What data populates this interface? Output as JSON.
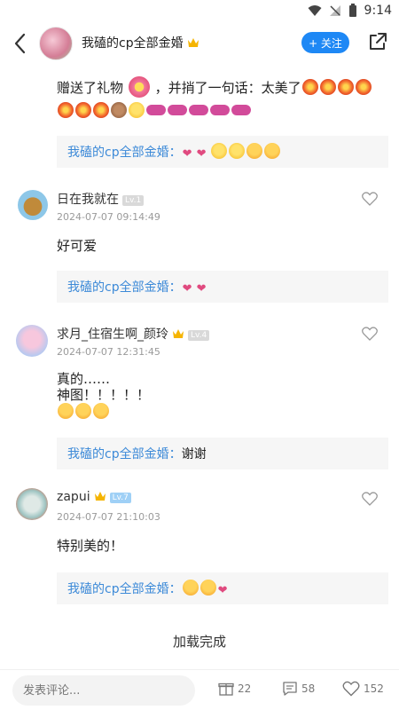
{
  "status_bar": {
    "time": "9:14"
  },
  "header": {
    "title": "我磕的cp全部金婚",
    "follow_label": "+ 关注"
  },
  "gift": {
    "text_a": "赠送了礼物",
    "text_b": "，并捎了一句话：太美了"
  },
  "first_reply": {
    "author": "我磕的cp全部金婚："
  },
  "comments": [
    {
      "name": "日在我就在",
      "level": "Lv.1",
      "time": "2024-07-07 09:14:49",
      "body": "好可爱",
      "reply_author": "我磕的cp全部金婚："
    },
    {
      "name": "求月_住宿生啊_颜玲",
      "level": "Lv.4",
      "time": "2024-07-07 12:31:45",
      "body_line1": "真的……",
      "body_line2": "神图！！！！！",
      "reply_author": "我磕的cp全部金婚：",
      "reply_text": "谢谢"
    },
    {
      "name": "zapui",
      "level": "Lv.7",
      "time": "2024-07-07 21:10:03",
      "body": "特别美的！",
      "reply_author": "我磕的cp全部金婚："
    }
  ],
  "load_status": "加载完成",
  "bottom_bar": {
    "comment_placeholder": "发表评论...",
    "gift_count": "22",
    "comment_count": "58",
    "like_count": "152"
  },
  "colors": {
    "accent": "#1e88f5",
    "reply_author": "#3d8ad8",
    "heart": "#e04a7f"
  },
  "icons": [
    "back-arrow-icon",
    "share-icon",
    "crown-icon",
    "heart-outline-icon",
    "gift-icon",
    "comment-icon",
    "like-icon"
  ]
}
